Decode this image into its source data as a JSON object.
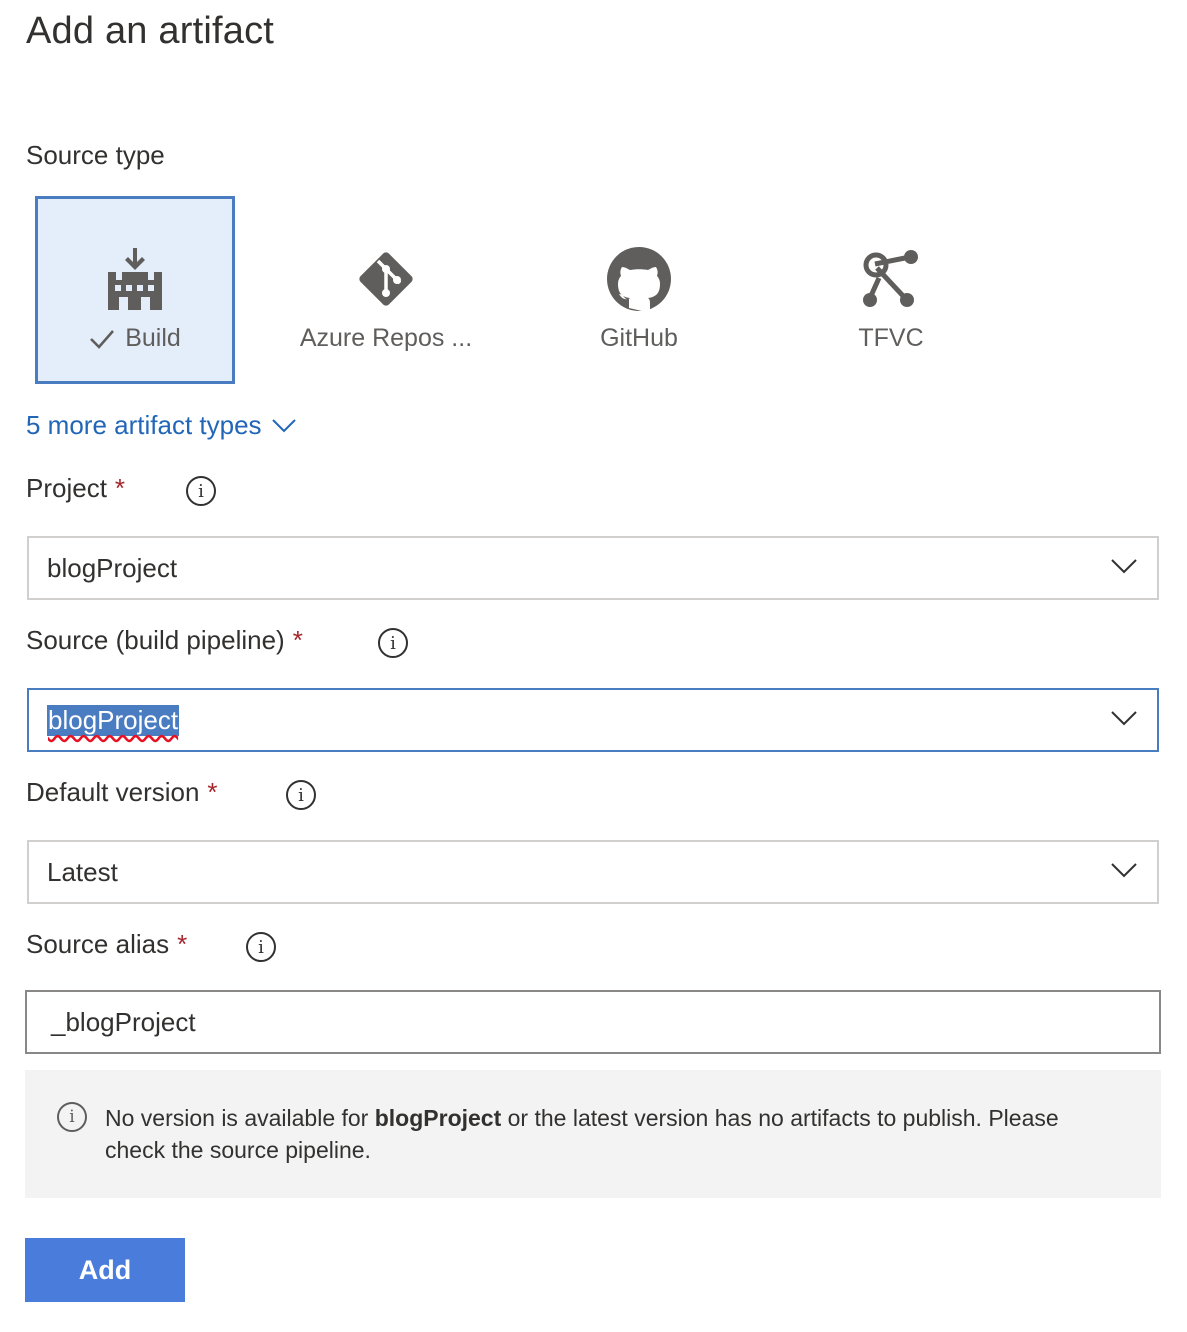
{
  "title": "Add an artifact",
  "source_type": {
    "label": "Source type",
    "tiles": [
      {
        "label": "Build",
        "icon": "build-icon",
        "selected": true
      },
      {
        "label": "Azure Repos ...",
        "icon": "git-icon",
        "selected": false
      },
      {
        "label": "GitHub",
        "icon": "github-icon",
        "selected": false
      },
      {
        "label": "TFVC",
        "icon": "tfvc-icon",
        "selected": false
      }
    ],
    "more_link": "5 more artifact types"
  },
  "project": {
    "label": "Project",
    "required_mark": "*",
    "value": "blogProject"
  },
  "source_pipeline": {
    "label": "Source (build pipeline)",
    "required_mark": "*",
    "value": "blogProject"
  },
  "default_version": {
    "label": "Default version",
    "required_mark": "*",
    "value": "Latest"
  },
  "source_alias": {
    "label": "Source alias",
    "required_mark": "*",
    "value": "_blogProject"
  },
  "notice": {
    "prefix": "No version is available for ",
    "bold": "blogProject",
    "suffix": " or the latest version has no artifacts to publish. Please check the source pipeline."
  },
  "add_button": "Add",
  "colors": {
    "accent": "#4a7cc2",
    "button": "#4a7cdc",
    "link": "#2266b8",
    "required": "#a4262c"
  }
}
